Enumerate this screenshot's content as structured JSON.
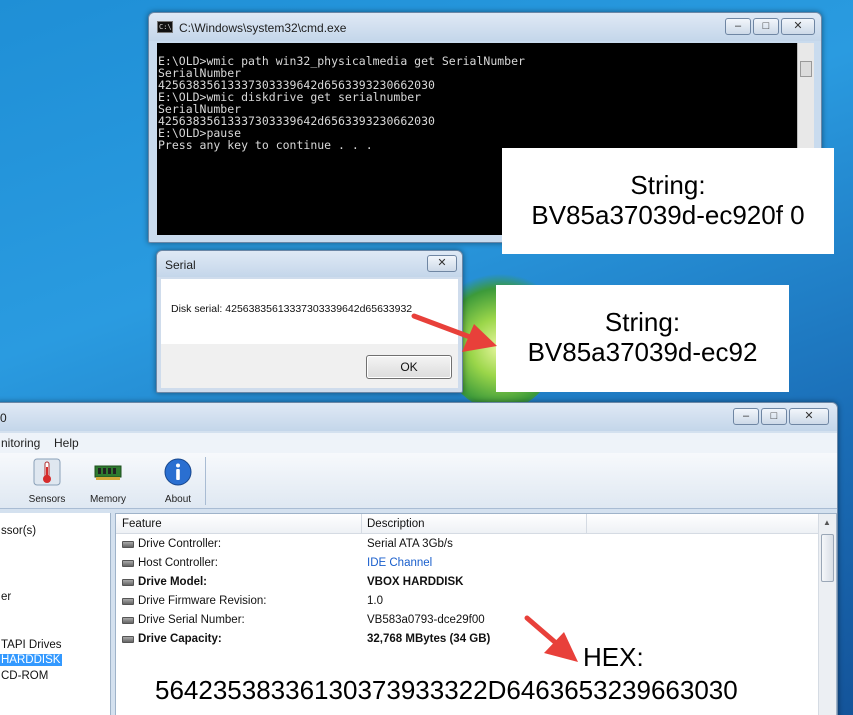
{
  "cmd_window": {
    "title": "C:\\Windows\\system32\\cmd.exe",
    "icon_text": "C:\\",
    "lines": [
      "E:\\OLD>wmic path win32_physicalmedia get SerialNumber",
      "SerialNumber",
      "42563835613337303339642d6563393230662030",
      "",
      "",
      "E:\\OLD>wmic diskdrive get serialnumber",
      "SerialNumber",
      "42563835613337303339642d6563393230662030",
      "",
      "",
      "E:\\OLD>pause",
      "Press any key to continue . . ."
    ],
    "btn_minimize": "–",
    "btn_maximize": "□",
    "btn_close": "✕"
  },
  "serial_dialog": {
    "title": "Serial",
    "message": "Disk serial: 42563835613337303339642d65633932",
    "ok_label": "OK",
    "btn_close": "✕"
  },
  "callouts": {
    "top_line1": "String:",
    "top_line2": "BV85a37039d-ec920f 0",
    "mid_line1": "String:",
    "mid_line2": "BV85a37039d-ec92",
    "hex_label": "HEX:",
    "hex_value": "56423538336130373933322D6463653239663030"
  },
  "app_window": {
    "title_fragment": "0",
    "menu": [
      "nitoring",
      "Help"
    ],
    "toolbar": [
      {
        "label": "Sensors",
        "icon": "thermometer-icon"
      },
      {
        "label": "Memory",
        "icon": "memory-chip-icon"
      },
      {
        "label": "About",
        "icon": "info-icon"
      }
    ],
    "btn_minimize": "–",
    "btn_maximize": "□",
    "btn_close": "✕",
    "tree": [
      "ssor(s)",
      "er",
      "TAPI Drives",
      "HARDDISK",
      "CD-ROM"
    ],
    "columns": [
      "Feature",
      "Description"
    ],
    "rows": [
      {
        "feature": "Drive Controller:",
        "description": "Serial ATA 3Gb/s"
      },
      {
        "feature": "Host Controller:",
        "description": "IDE Channel"
      },
      {
        "feature": "Drive Model:",
        "description": "VBOX HARDDISK"
      },
      {
        "feature": "Drive Firmware Revision:",
        "description": "1.0"
      },
      {
        "feature": "Drive Serial Number:",
        "description": "VB583a0793-dce29f00"
      },
      {
        "feature": "Drive Capacity:",
        "description": "32,768 MBytes (34 GB)"
      }
    ]
  },
  "colors": {
    "desktop": "#1f8fd6",
    "arrow": "#e8403a",
    "link": "#1a5fcc",
    "selection": "#3399ff"
  }
}
